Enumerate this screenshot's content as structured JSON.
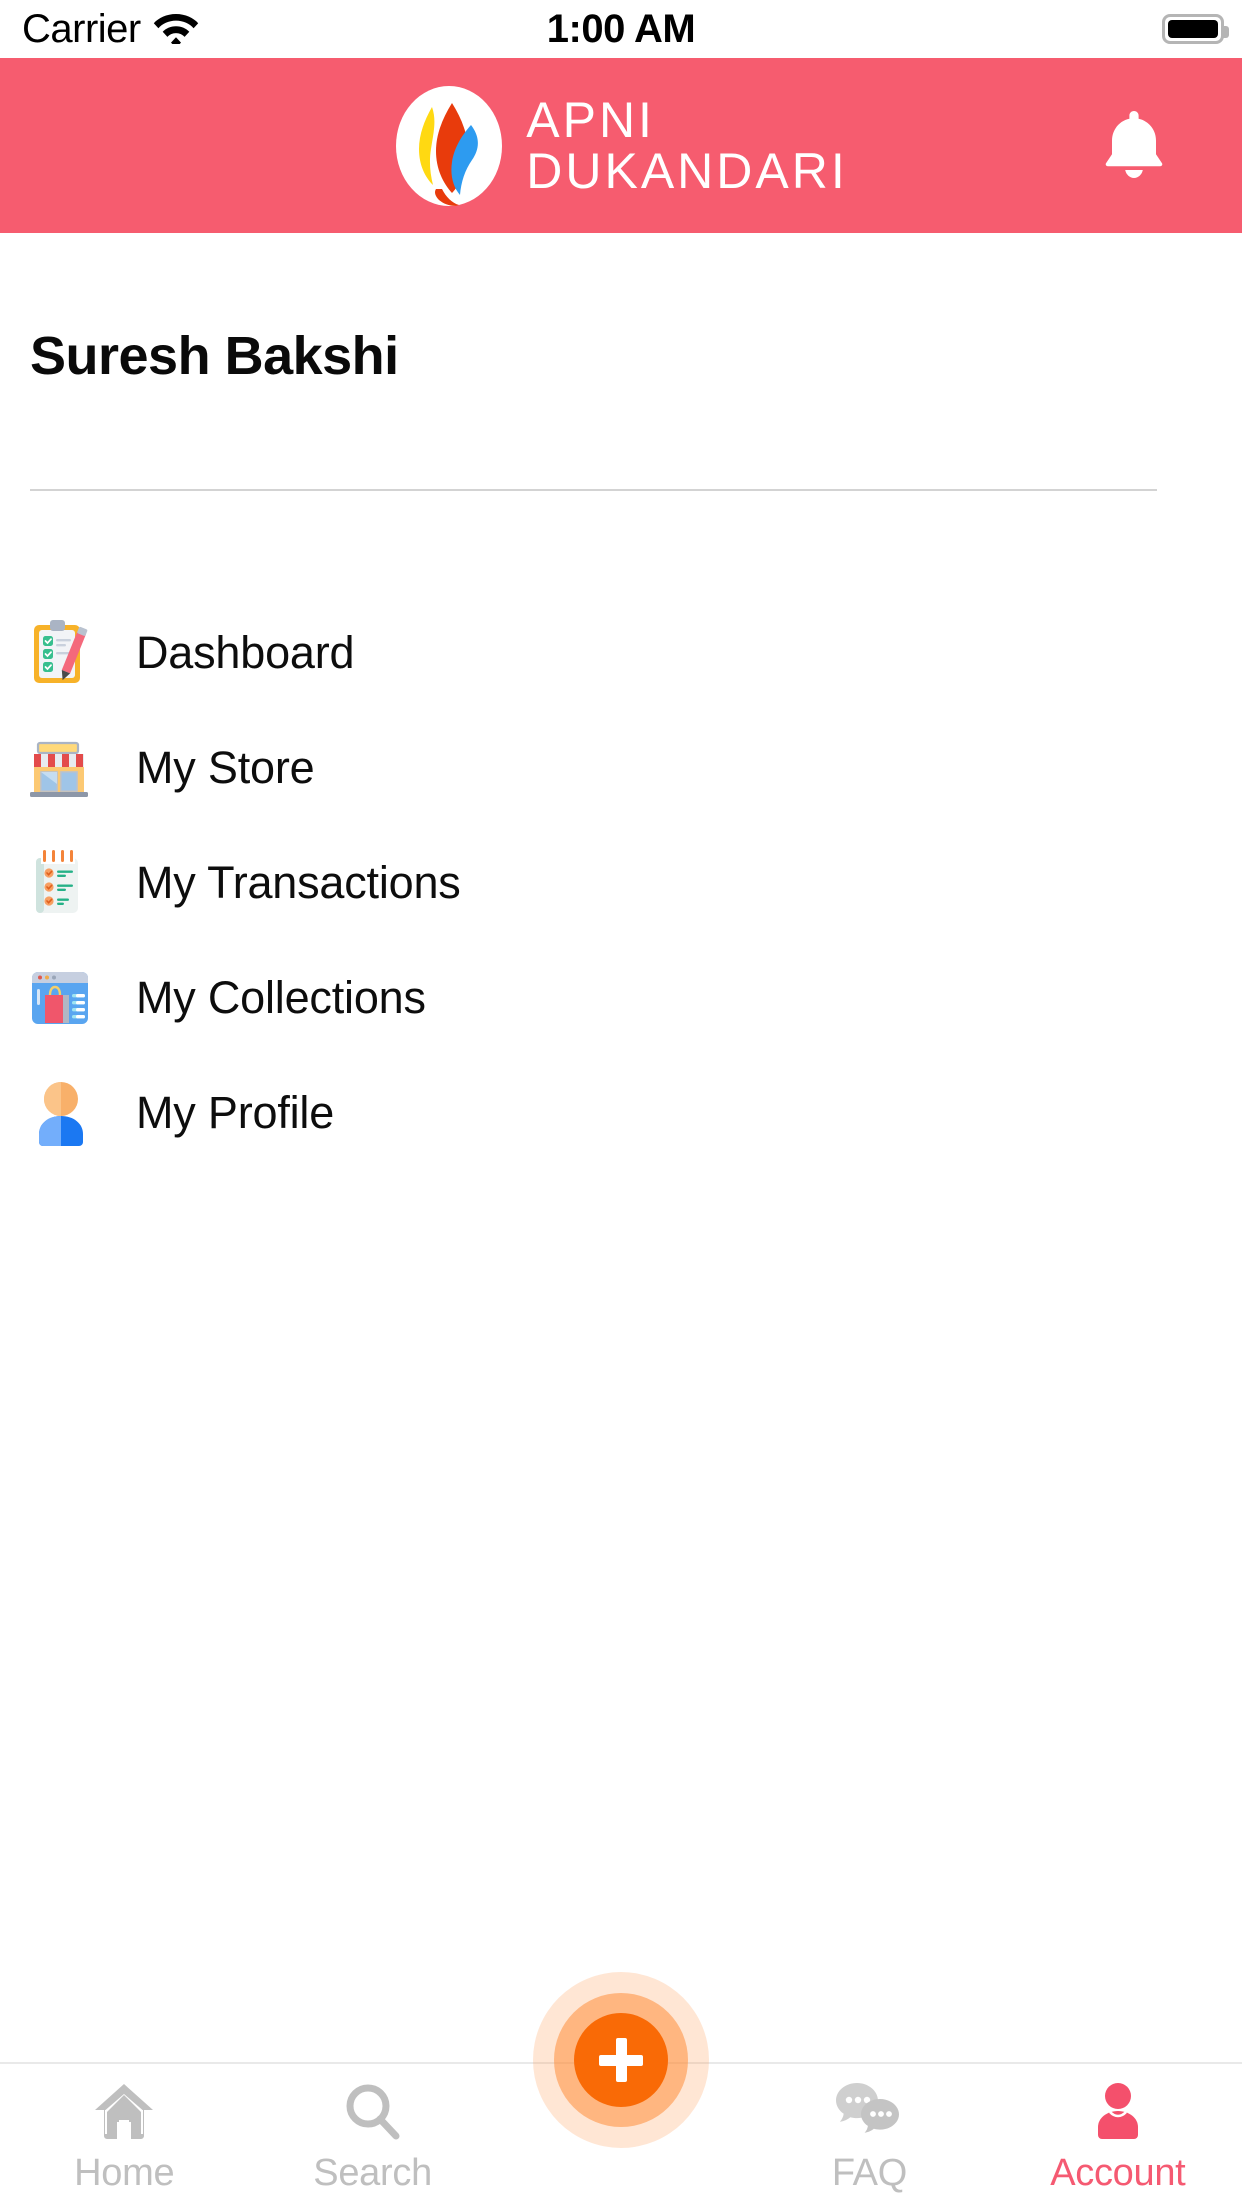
{
  "status_bar": {
    "carrier": "Carrier",
    "wifi_icon": "wifi-icon",
    "time": "1:00 AM",
    "battery_icon": "battery-full-icon"
  },
  "header": {
    "background_color": "#f65c6f",
    "logo_icon": "apni-dukandari-flame-logo",
    "brand_line1": "APNI",
    "brand_line2": "DUKANDARI",
    "notification_icon": "bell-icon"
  },
  "account": {
    "user_name": "Suresh Bakshi"
  },
  "menu": {
    "items": [
      {
        "label": "Dashboard",
        "icon": "clipboard-checklist-icon"
      },
      {
        "label": "My Store",
        "icon": "storefront-icon"
      },
      {
        "label": "My Transactions",
        "icon": "notepad-checklist-icon"
      },
      {
        "label": "My Collections",
        "icon": "shopping-bag-window-icon"
      },
      {
        "label": "My Profile",
        "icon": "person-avatar-icon"
      }
    ]
  },
  "tab_bar": {
    "active_color": "#f55a72",
    "inactive_color": "#bfbfbf",
    "fab": {
      "icon": "plus-icon",
      "color": "#f96a06"
    },
    "tabs": [
      {
        "label": "Home",
        "icon": "home-icon",
        "active": false
      },
      {
        "label": "Search",
        "icon": "search-icon",
        "active": false
      },
      {
        "label": "FAQ",
        "icon": "chat-bubbles-icon",
        "active": false
      },
      {
        "label": "Account",
        "icon": "person-icon",
        "active": true
      }
    ]
  }
}
